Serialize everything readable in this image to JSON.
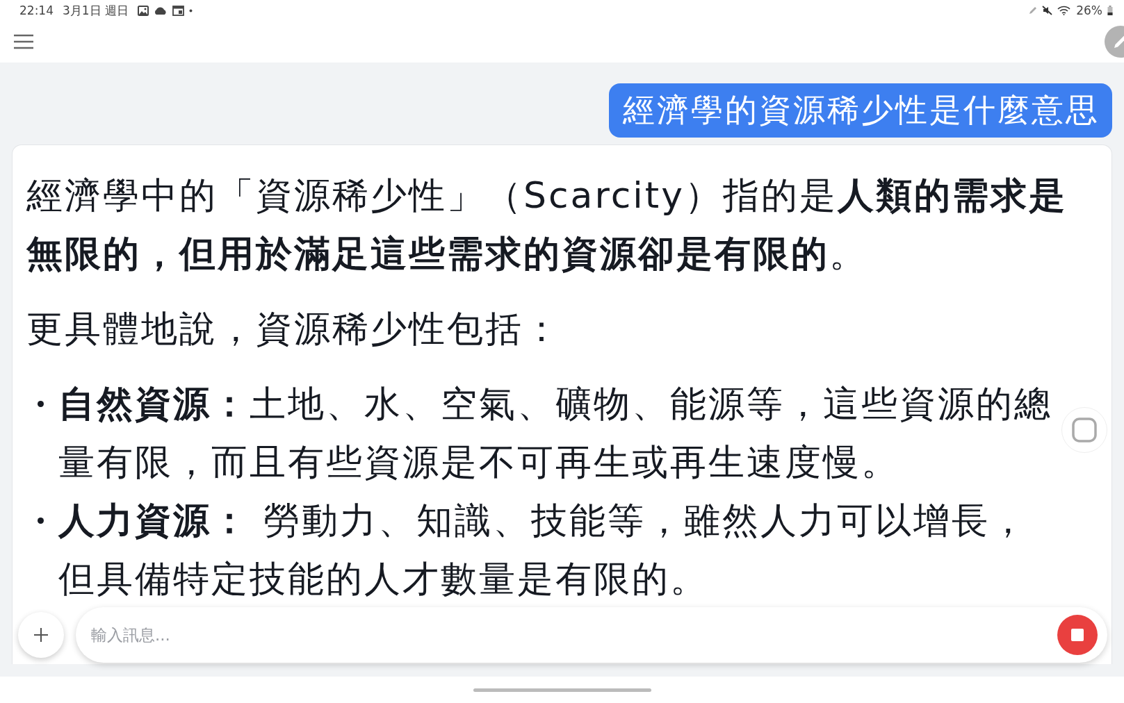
{
  "status_bar": {
    "time": "22:14",
    "date": "3月1日 週日",
    "battery": "26%"
  },
  "user_message": "經濟學的資源稀少性是什麼意思",
  "answer": {
    "paragraphs": [
      "經濟學中的「資源稀少性」（Scarcity）指的是**人類的需求是無限的，但用於滿足這些需求的資源卻是有限的**。",
      "更具體地說，資源稀少性包括："
    ],
    "bullets": [
      {
        "label": "自然資源：",
        "text": "土地、水、空氣、礦物、能源等，這些資源的總量有限，而且有些資源是不可再生或再生速度慢。"
      },
      {
        "label": "人力資源：",
        "text": " 勞動力、知識、技能等，雖然人力可以增長，但具備特定技能的人才數量是有限的。"
      }
    ]
  },
  "composer": {
    "placeholder": "輸入訊息..."
  }
}
